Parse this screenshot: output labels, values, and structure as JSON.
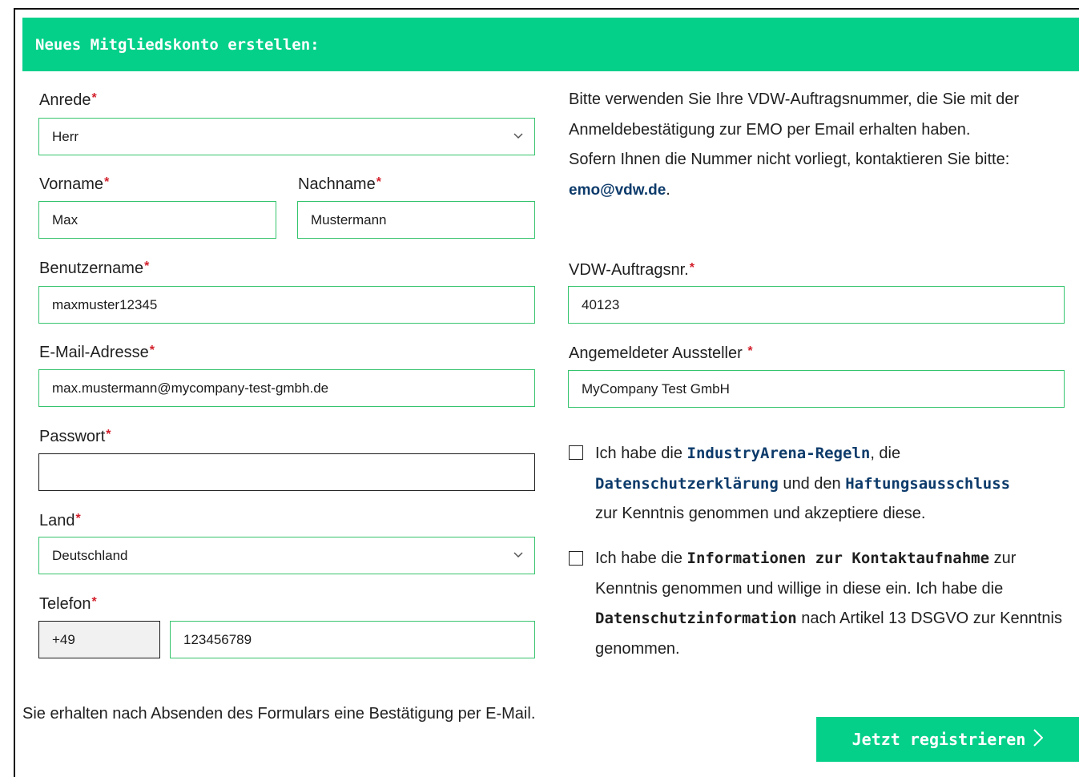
{
  "form": {
    "title": "Neues Mitgliedskonto erstellen:",
    "required_mark": "*",
    "salutation": {
      "label": "Anrede",
      "value": "Herr"
    },
    "first_name": {
      "label": "Vorname",
      "value": "Max"
    },
    "last_name": {
      "label": "Nachname",
      "value": "Mustermann"
    },
    "username": {
      "label": "Benutzername",
      "value": "maxmuster12345"
    },
    "email": {
      "label": "E-Mail-Adresse",
      "value": "max.mustermann@mycompany-test-gmbh.de"
    },
    "password": {
      "label": "Passwort",
      "value": ""
    },
    "country": {
      "label": "Land",
      "value": "Deutschland"
    },
    "phone": {
      "label": "Telefon",
      "prefix": "+49",
      "number": "123456789"
    },
    "order_number": {
      "label": "VDW-Auftragsnr.",
      "value": "40123"
    },
    "exhibitor": {
      "label": "Angemeldeter Aussteller",
      "value": "MyCompany Test GmbH"
    }
  },
  "info": {
    "text": "Bitte verwenden Sie Ihre VDW-Auftragsnummer, die Sie mit der Anmeldebestätigung zur EMO per Email erhalten haben.",
    "contact_prefix": "Sofern Ihnen die Nummer nicht vorliegt, kontaktieren Sie bitte: ",
    "contact_email": "emo@vdw.de",
    "contact_suffix": "."
  },
  "consent1": {
    "t1": "Ich habe die ",
    "link1": "IndustryArena-Regeln",
    "t2": ", die ",
    "link2": "Datenschutzerklärung",
    "t3": " und den ",
    "link3": "Haftungsausschluss",
    "t4": " zur Kenntnis genommen und akzeptiere diese."
  },
  "consent2": {
    "t1": "Ich habe die ",
    "bold1": "Informationen zur Kontaktaufnahme",
    "t2": " zur Kenntnis genommen und willige in diese ein. Ich habe die ",
    "bold2": "Datenschutzinformation",
    "t3": " nach Artikel 13 DSGVO zur Kenntnis genommen."
  },
  "footer": {
    "note": "Sie erhalten nach Absenden des Formulars eine Bestätigung per E-Mail.",
    "submit_label": "Jetzt registrieren"
  },
  "icons": {
    "dropdown": "chevron-down-icon",
    "submit": "chevron-right-icon"
  },
  "colors": {
    "accent": "#04d08a",
    "link": "#0d3b6b",
    "required": "#d21f2b",
    "field_border": "#36c46e"
  }
}
